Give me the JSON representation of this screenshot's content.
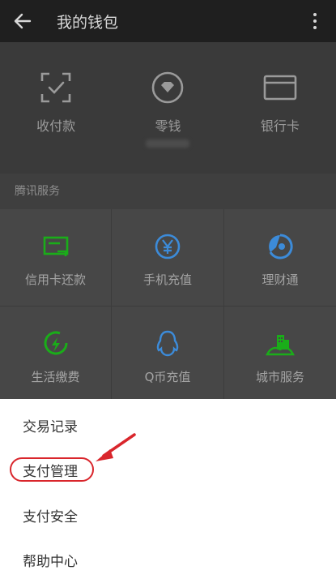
{
  "app_bar": {
    "title": "我的钱包",
    "back_icon": "arrow-left-icon",
    "more_icon": "more-vertical-icon"
  },
  "wallet": {
    "items": [
      {
        "label": "收付款",
        "icon": "scan-frame-icon"
      },
      {
        "label": "零钱",
        "icon": "coin-diamond-icon"
      },
      {
        "label": "银行卡",
        "icon": "bank-card-icon"
      }
    ]
  },
  "services": {
    "title": "腾讯服务",
    "items": [
      {
        "label": "信用卡还款",
        "icon": "credit-card-icon",
        "color": "#1aad19"
      },
      {
        "label": "手机充值",
        "icon": "yen-coin-icon",
        "color": "#3c8bd9"
      },
      {
        "label": "理财通",
        "icon": "wealth-circle-icon",
        "color": "#3c8bd9"
      },
      {
        "label": "生活缴费",
        "icon": "lightning-icon",
        "color": "#1aad19"
      },
      {
        "label": "Q币充值",
        "icon": "qq-penguin-icon",
        "color": "#3c8bd9"
      },
      {
        "label": "城市服务",
        "icon": "city-buildings-icon",
        "color": "#1aad19"
      }
    ]
  },
  "menu": {
    "items": [
      {
        "label": "交易记录"
      },
      {
        "label": "支付管理",
        "highlighted": true
      },
      {
        "label": "支付安全"
      },
      {
        "label": "帮助中心"
      }
    ]
  },
  "annotation": {
    "color": "#d9262c",
    "arrow_icon": "red-arrow-icon"
  }
}
